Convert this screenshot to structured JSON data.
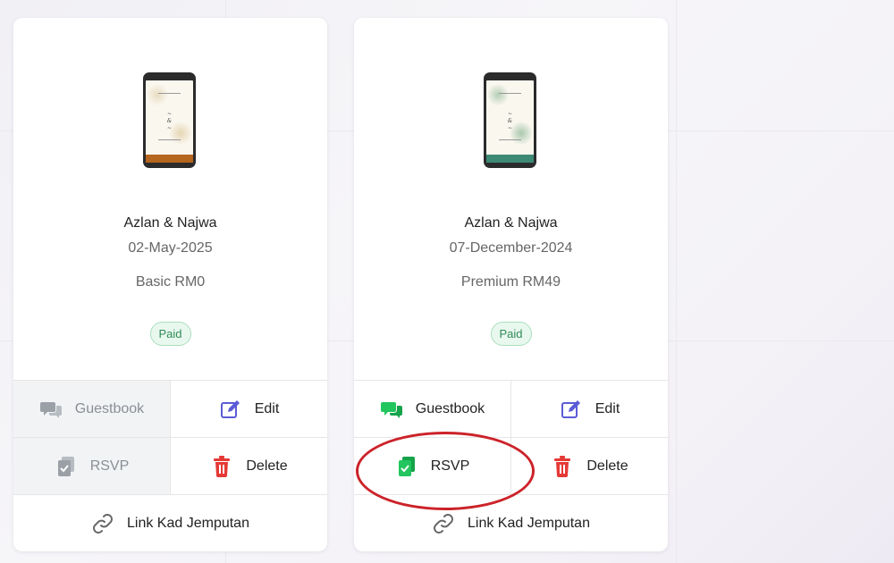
{
  "cards": [
    {
      "names": "Azlan & Najwa",
      "date": "02-May-2025",
      "plan": "Basic RM0",
      "status": "Paid",
      "actions": {
        "guestbook": "Guestbook",
        "edit": "Edit",
        "rsvp": "RSVP",
        "delete": "Delete",
        "link": "Link Kad Jemputan"
      },
      "guestbook_enabled": false,
      "rsvp_enabled": false
    },
    {
      "names": "Azlan & Najwa",
      "date": "07-December-2024",
      "plan": "Premium RM49",
      "status": "Paid",
      "actions": {
        "guestbook": "Guestbook",
        "edit": "Edit",
        "rsvp": "RSVP",
        "delete": "Delete",
        "link": "Link Kad Jemputan"
      },
      "guestbook_enabled": true,
      "rsvp_enabled": true
    }
  ],
  "colors": {
    "guestbook_active": "#22c55e",
    "rsvp_active": "#22c55e",
    "edit_icon": "#5b5bd6",
    "delete_icon": "#e53935",
    "disabled_icon": "#9aa0a6",
    "badge_text": "#2f8a55",
    "highlight": "#cc2229"
  },
  "icons": {
    "guestbook": "chat-bubbles-icon",
    "edit": "pencil-square-icon",
    "rsvp": "clipboard-check-icon",
    "delete": "trash-icon",
    "link": "link-icon"
  }
}
